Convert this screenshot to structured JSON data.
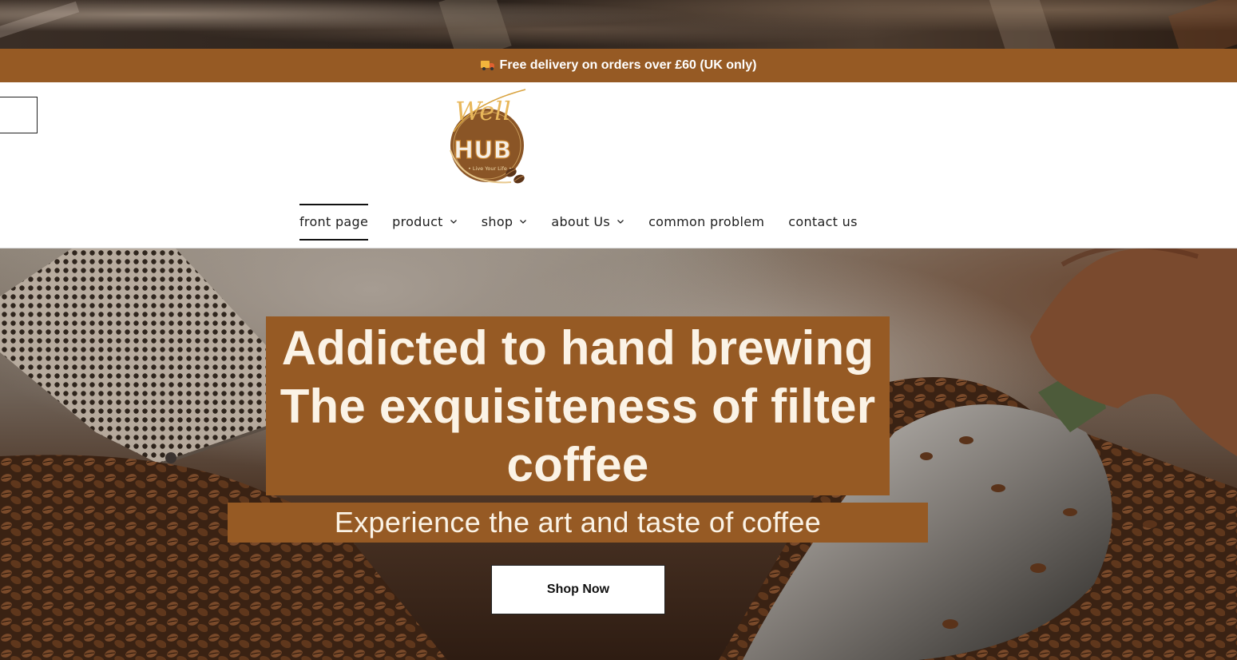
{
  "announcement": {
    "icon": "delivery-truck-icon",
    "text": "Free delivery on orders over £60 (UK only)"
  },
  "header": {
    "logo": {
      "script_text": "Well",
      "main_text": "HUB",
      "tagline": "Live Your Life"
    },
    "menu_toggle_icon": "menu-icon"
  },
  "nav": {
    "items": [
      {
        "label": "front page",
        "active": true,
        "has_dropdown": false
      },
      {
        "label": "product",
        "active": false,
        "has_dropdown": true
      },
      {
        "label": "shop",
        "active": false,
        "has_dropdown": true
      },
      {
        "label": "about Us",
        "active": false,
        "has_dropdown": true
      },
      {
        "label": "common problem",
        "active": false,
        "has_dropdown": false
      },
      {
        "label": "contact us",
        "active": false,
        "has_dropdown": false
      }
    ]
  },
  "hero": {
    "headline_line1": "Addicted to hand brewing",
    "headline_line2": "The exquisiteness of filter coffee",
    "subline": "Experience the art and taste of coffee",
    "cta_label": "Shop Now"
  },
  "colors": {
    "brand_brown": "#965a24",
    "hero_text": "#fbf3e6",
    "logo_gold": "#d9a441"
  }
}
